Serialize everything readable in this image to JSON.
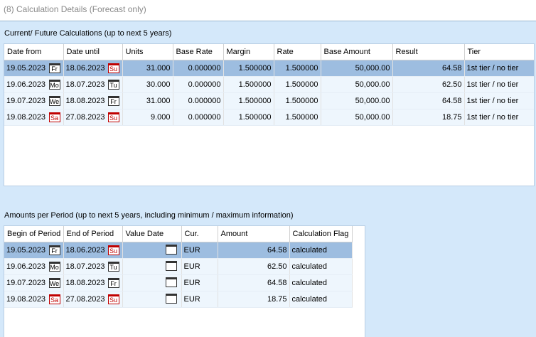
{
  "title": "(8) Calculation Details (Forecast only)",
  "calc": {
    "label": "Current/ Future Calculations (up to next 5 years)",
    "headers": [
      "Date from",
      "Date until",
      "Units",
      "Base Rate",
      "Margin",
      "Rate",
      "Base Amount",
      "Result",
      "Tier"
    ],
    "rows": [
      {
        "from": "19.05.2023",
        "from_day": "Fr",
        "until": "18.06.2023",
        "until_day": "Su",
        "units": "31.000",
        "base_rate": "0.000000",
        "margin": "1.500000",
        "rate": "1.500000",
        "base_amount": "50,000.00",
        "result": "64.58",
        "tier": "1st tier / no tier"
      },
      {
        "from": "19.06.2023",
        "from_day": "Mo",
        "until": "18.07.2023",
        "until_day": "Tu",
        "units": "30.000",
        "base_rate": "0.000000",
        "margin": "1.500000",
        "rate": "1.500000",
        "base_amount": "50,000.00",
        "result": "62.50",
        "tier": "1st tier / no tier"
      },
      {
        "from": "19.07.2023",
        "from_day": "We",
        "until": "18.08.2023",
        "until_day": "Fr",
        "units": "31.000",
        "base_rate": "0.000000",
        "margin": "1.500000",
        "rate": "1.500000",
        "base_amount": "50,000.00",
        "result": "64.58",
        "tier": "1st tier / no tier"
      },
      {
        "from": "19.08.2023",
        "from_day": "Sa",
        "until": "27.08.2023",
        "until_day": "Su",
        "units": "9.000",
        "base_rate": "0.000000",
        "margin": "1.500000",
        "rate": "1.500000",
        "base_amount": "50,000.00",
        "result": "18.75",
        "tier": "1st tier / no tier"
      }
    ]
  },
  "amounts": {
    "label": "Amounts per Period (up to next 5 years, including minimum / maximum information)",
    "headers": [
      "Begin of Period",
      "End of Period",
      "Value Date",
      "Cur.",
      "Amount",
      "Calculation Flag"
    ],
    "rows": [
      {
        "begin": "19.05.2023",
        "begin_day": "Fr",
        "end": "18.06.2023",
        "end_day": "Su",
        "cur": "EUR",
        "amount": "64.58",
        "flag": "calculated"
      },
      {
        "begin": "19.06.2023",
        "begin_day": "Mo",
        "end": "18.07.2023",
        "end_day": "Tu",
        "cur": "EUR",
        "amount": "62.50",
        "flag": "calculated"
      },
      {
        "begin": "19.07.2023",
        "begin_day": "We",
        "end": "18.08.2023",
        "end_day": "Fr",
        "cur": "EUR",
        "amount": "64.58",
        "flag": "calculated"
      },
      {
        "begin": "19.08.2023",
        "begin_day": "Sa",
        "end": "27.08.2023",
        "end_day": "Su",
        "cur": "EUR",
        "amount": "18.75",
        "flag": "calculated"
      }
    ]
  },
  "icons": {
    "calendar": "calendar-icon"
  },
  "colors": {
    "selected_row": "#9dbde0",
    "weekend": "#c00000",
    "panel": "#d4e8fa"
  }
}
